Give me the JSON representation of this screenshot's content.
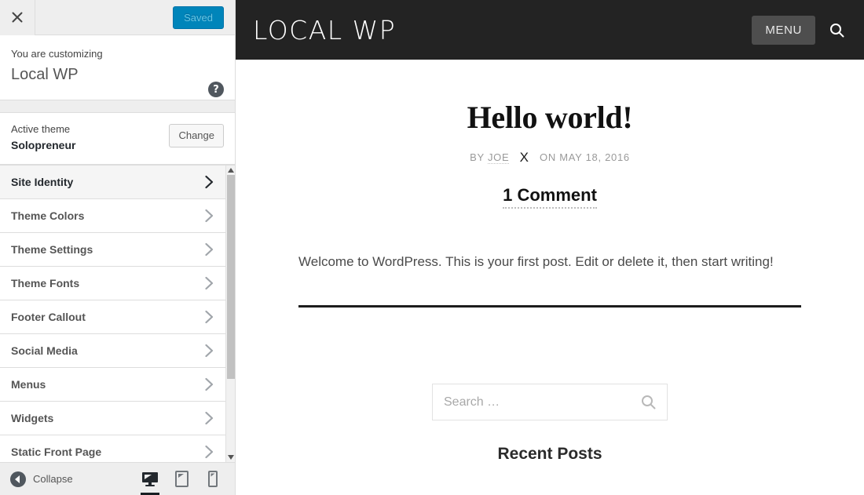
{
  "customizer": {
    "close_icon": "close-icon",
    "save_label": "Saved",
    "customizing_label": "You are customizing",
    "site_name": "Local WP",
    "help_icon": "help-icon",
    "active_theme_label": "Active theme",
    "active_theme_name": "Solopreneur",
    "change_label": "Change",
    "sections": [
      {
        "label": "Site Identity",
        "hovered": true
      },
      {
        "label": "Theme Colors",
        "hovered": false
      },
      {
        "label": "Theme Settings",
        "hovered": false
      },
      {
        "label": "Theme Fonts",
        "hovered": false
      },
      {
        "label": "Footer Callout",
        "hovered": false
      },
      {
        "label": "Social Media",
        "hovered": false
      },
      {
        "label": "Menus",
        "hovered": false
      },
      {
        "label": "Widgets",
        "hovered": false
      },
      {
        "label": "Static Front Page",
        "hovered": false
      }
    ],
    "collapse_label": "Collapse",
    "devices": [
      {
        "name": "desktop",
        "active": true
      },
      {
        "name": "tablet",
        "active": false
      },
      {
        "name": "mobile",
        "active": false
      }
    ],
    "accent_color": "#0085ba",
    "sidebar_bg": "#eeeeee"
  },
  "preview": {
    "site_title": "LOCAL WP",
    "menu_label": "MENU",
    "search_toggle_icon": "search-icon",
    "post": {
      "title": "Hello world!",
      "byline_prefix": "BY",
      "author": "JOE",
      "byline_separator": "X",
      "date_text": "ON MAY 18, 2016",
      "comments_label": "1 Comment",
      "body": "Welcome to WordPress. This is your first post. Edit or delete it, then start writing!"
    },
    "search": {
      "placeholder": "Search …",
      "value": "",
      "submit_icon": "search-icon"
    },
    "below_fold_text": "Recent Posts",
    "header_bg": "#232323"
  }
}
